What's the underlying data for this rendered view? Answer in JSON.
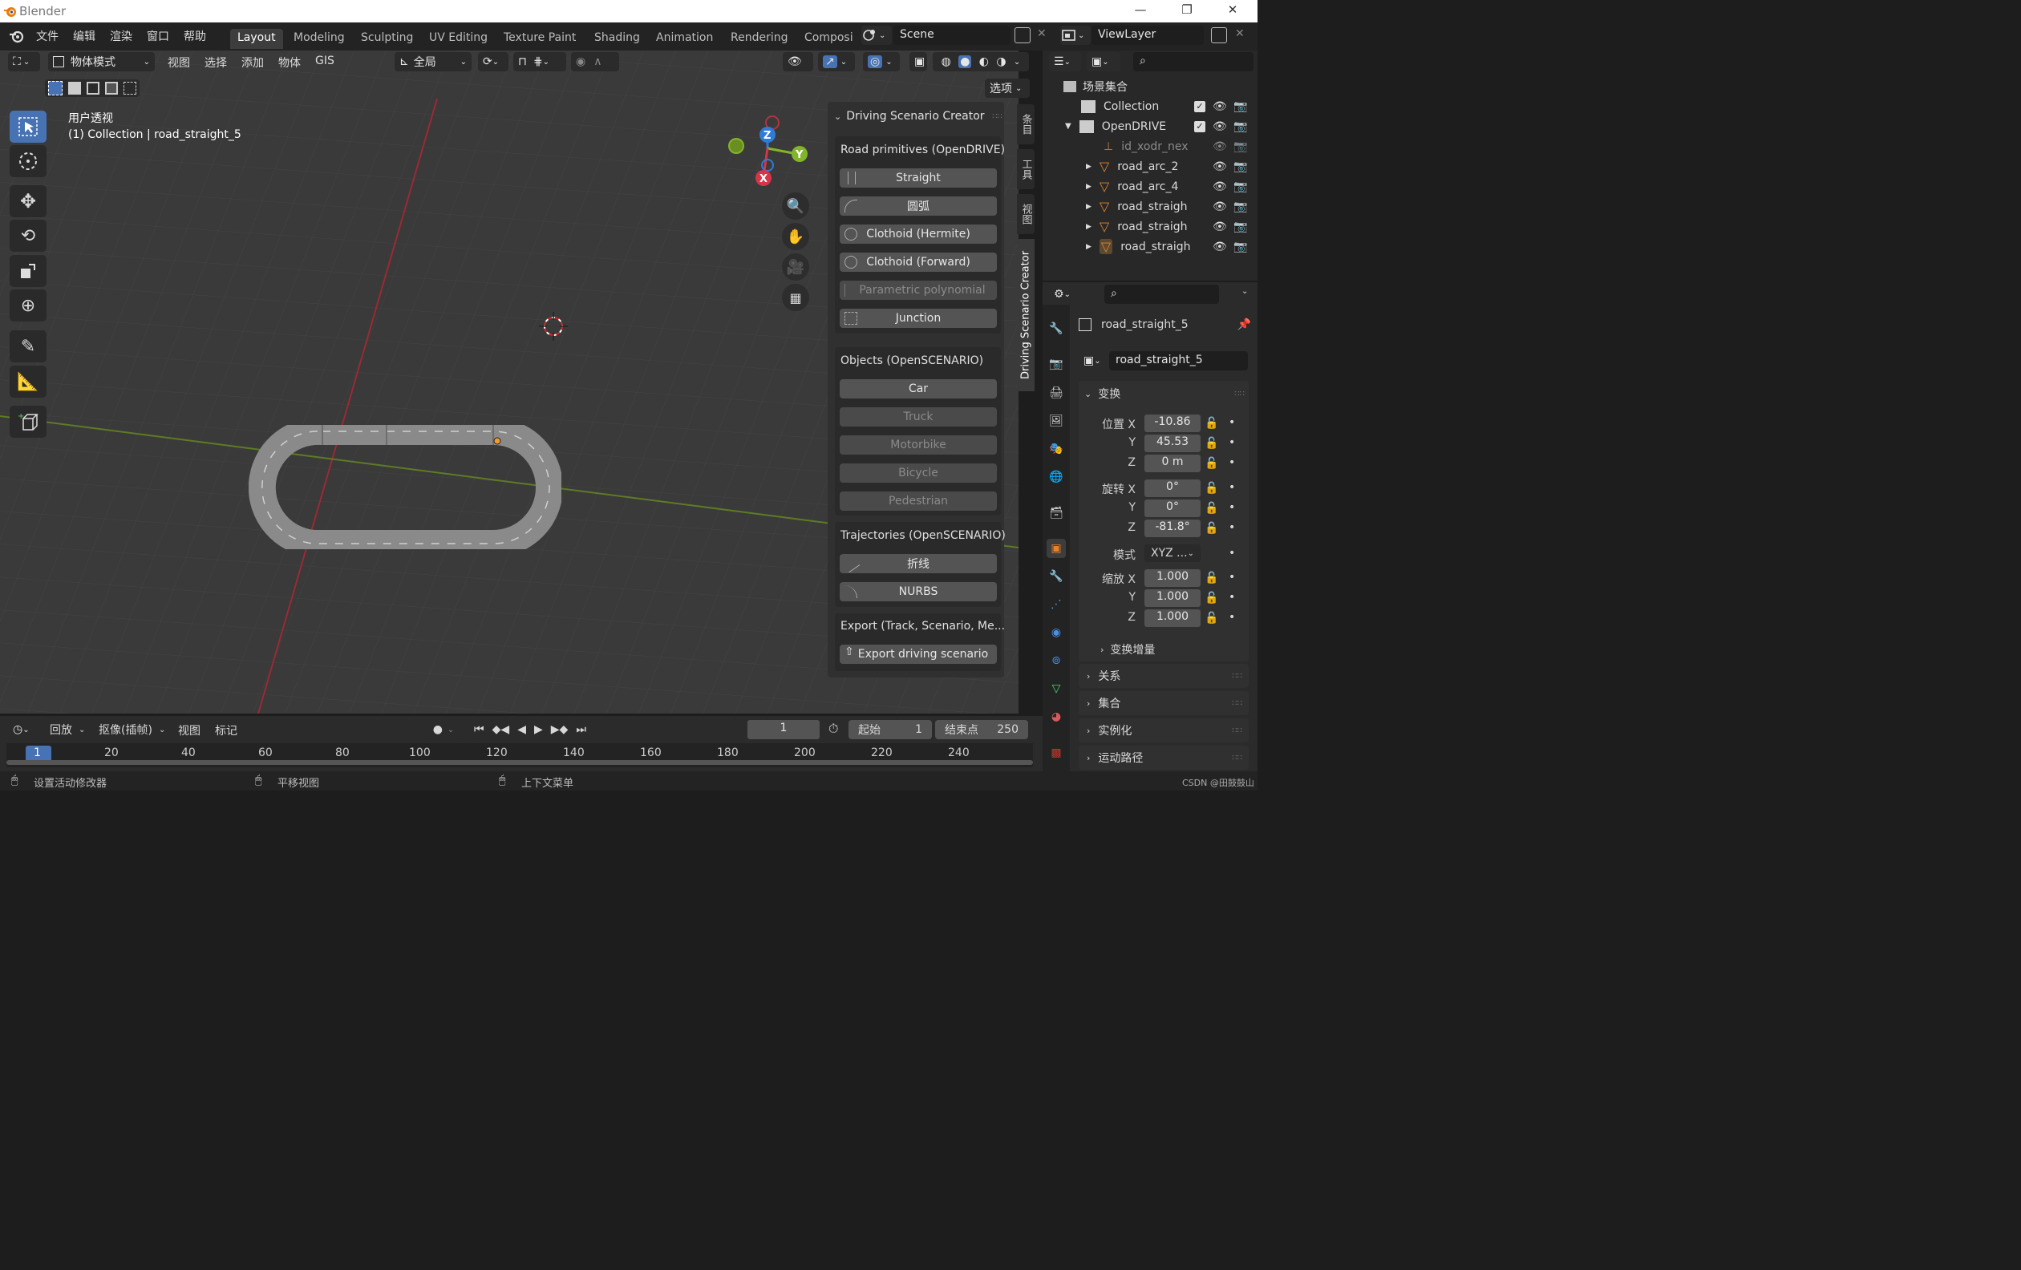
{
  "titlebar": {
    "title": "Blender",
    "minimize": "—",
    "restore": "❐",
    "close": "✕"
  },
  "menu": [
    "文件",
    "编辑",
    "渲染",
    "窗口",
    "帮助"
  ],
  "workspaces": [
    "Layout",
    "Modeling",
    "Sculpting",
    "UV Editing",
    "Texture Paint",
    "Shading",
    "Animation",
    "Rendering",
    "Composi"
  ],
  "scene": {
    "label": "Scene",
    "viewlayer": "ViewLayer"
  },
  "viewport_header": {
    "mode": "物体模式",
    "menus": [
      "视图",
      "选择",
      "添加",
      "物体",
      "GIS"
    ],
    "orientation": "全局",
    "options": "选项"
  },
  "viewport": {
    "view_name": "用户透视",
    "collection_info": "(1) Collection | road_straight_5",
    "gizmo": {
      "x": "X",
      "y": "Y",
      "z": "Z"
    }
  },
  "colors": {
    "accent": "#4772b3",
    "x_axis": "#d6344a",
    "y_axis": "#82b52a",
    "z_axis": "#2f7bd6",
    "orange": "#e4832b"
  },
  "npanel": {
    "title": "Driving Scenario Creator",
    "sections": {
      "road": {
        "title": "Road primitives (OpenDRIVE)",
        "buttons": [
          {
            "label": "Straight",
            "enabled": true
          },
          {
            "label": "圆弧",
            "enabled": true
          },
          {
            "label": "Clothoid (Hermite)",
            "enabled": true
          },
          {
            "label": "Clothoid (Forward)",
            "enabled": true
          },
          {
            "label": "Parametric polynomial",
            "enabled": false
          },
          {
            "label": "Junction",
            "enabled": true
          }
        ]
      },
      "objects": {
        "title": "Objects (OpenSCENARIO)",
        "buttons": [
          {
            "label": "Car",
            "enabled": true
          },
          {
            "label": "Truck",
            "enabled": false
          },
          {
            "label": "Motorbike",
            "enabled": false
          },
          {
            "label": "Bicycle",
            "enabled": false
          },
          {
            "label": "Pedestrian",
            "enabled": false
          }
        ]
      },
      "trajectories": {
        "title": "Trajectories (OpenSCENARIO)",
        "buttons": [
          {
            "label": "折线",
            "enabled": true
          },
          {
            "label": "NURBS",
            "enabled": true
          }
        ]
      },
      "export": {
        "title": "Export (Track, Scenario, Me...",
        "button": "Export driving scenario"
      }
    },
    "side_tabs": [
      "条目",
      "工具",
      "视图",
      "Driving Scenario Creator"
    ]
  },
  "outliner": {
    "root": "场景集合",
    "rows": [
      {
        "name": "Collection",
        "type": "collection",
        "indent": 1
      },
      {
        "name": "OpenDRIVE",
        "type": "collection",
        "indent": 1,
        "expanded": true
      },
      {
        "name": "id_xodr_nex",
        "type": "empty",
        "indent": 2
      },
      {
        "name": "road_arc_2",
        "type": "mesh",
        "indent": 2
      },
      {
        "name": "road_arc_4",
        "type": "mesh",
        "indent": 2
      },
      {
        "name": "road_straigh",
        "type": "mesh",
        "indent": 2
      },
      {
        "name": "road_straigh",
        "type": "mesh",
        "indent": 2
      },
      {
        "name": "road_straigh",
        "type": "mesh",
        "indent": 2
      }
    ]
  },
  "properties": {
    "object_name": "road_straight_5",
    "datablock": "road_straight_5",
    "transform_title": "变换",
    "location_label": "位置",
    "rotation_label": "旋转",
    "scale_label": "缩放",
    "mode_label": "模式",
    "mode_value": "XYZ ...",
    "location": {
      "x": "-10.86",
      "y": "45.53",
      "z": "0 m"
    },
    "rotation": {
      "x": "0°",
      "y": "0°",
      "z": "-81.8°"
    },
    "scale": {
      "x": "1.000",
      "y": "1.000",
      "z": "1.000"
    },
    "axis": {
      "x": "X",
      "y": "Y",
      "z": "Z"
    },
    "delta": "变换增量",
    "subsections": [
      "关系",
      "集合",
      "实例化",
      "运动路径"
    ]
  },
  "timeline": {
    "menus": [
      "回放",
      "抠像(插帧)",
      "视图",
      "标记"
    ],
    "current_frame": "1",
    "start_label": "起始",
    "start": "1",
    "end_label": "结束点",
    "end": "250",
    "ticks": [
      "1",
      "20",
      "40",
      "60",
      "80",
      "100",
      "120",
      "140",
      "160",
      "180",
      "200",
      "220",
      "240"
    ]
  },
  "statusbar": {
    "left": "设置活动修改器",
    "mid": "平移视图",
    "right": "上下文菜单",
    "watermark": "CSDN @田鼓鼓山"
  }
}
